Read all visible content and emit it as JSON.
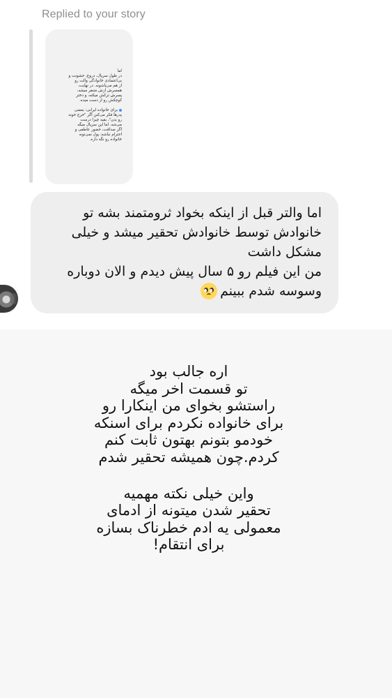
{
  "header": {
    "replied_label": "Replied to your story"
  },
  "story": {
    "paragraph_1": "اما\nدر طول سریال، دروغ، خشونت و\nبی‌اعتمادی خانوادگی والت رو\nاز هم می‌پاشونه. در نهایت،\nهمسرش ازش متنفر میشه،\nپسرش ترکش میکنه، و دختر\nکوچکش رو از دست میده.",
    "paragraph_2": "برای خانواده ایرانی: بعضی\nپدرها فکر می‌کنن اگر \"خرج خونه\nرو بدن\"، بقیه چیزا درست\nمی‌شه. اما این سریال میگه\nاگر صداقت، حضور عاطفی و\nاحترام نباشه، پول نمی‌تونه\nخانواده رو نگه داره."
  },
  "message": {
    "lines": [
      "اما والتر قبل از اینکه بخواد ثرومتمند بشه تو",
      "خانوادش توسط خانوادش تحقیر میشد و خیلی",
      "مشکل داشت",
      "من این فیلم رو ۵ سال پیش دیدم و الان دوباره",
      "وسوسه شدم ببینم"
    ],
    "emoji_name": "pleading-face-emoji"
  },
  "reply": {
    "paragraph_1": [
      "اره جالب بود",
      "تو قسمت اخر میگه",
      "راستشو بخوای من اینکارا رو",
      "برای خانواده نکردم برای اسنکه",
      "خودمو بتونم بهتون ثابت کنم",
      "کردم.چون همیشه تحقیر شدم"
    ],
    "paragraph_2": [
      "واین خیلی نکته مهمیه",
      "تحقیر شدن میتونه از ادمای",
      "معمولی یه ادم خطرناک بسازه",
      "برای انتقام!"
    ]
  },
  "colors": {
    "top_background": "#ffffff",
    "bottom_background": "#f7f7f7",
    "bubble_background": "#eeeeef",
    "secondary_text": "#8e8e93"
  },
  "icons": {
    "avatar": "avatar",
    "story_blue_dot": "story-blue-dot-icon"
  }
}
